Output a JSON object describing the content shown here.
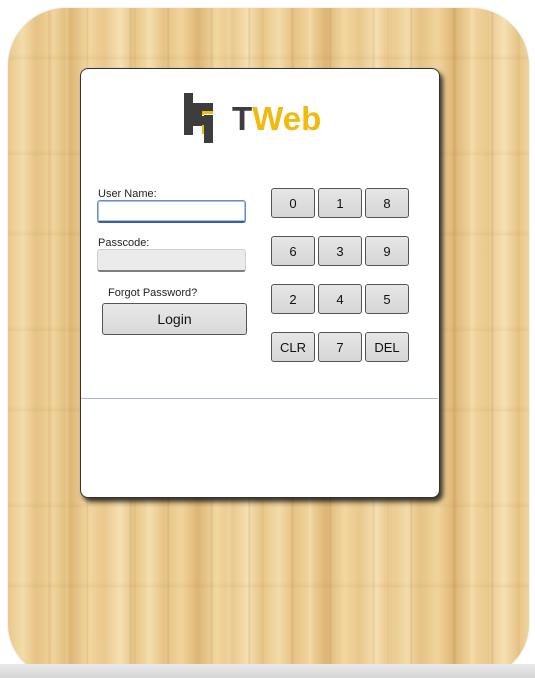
{
  "logo": {
    "t_text": "T",
    "web_text": "Web",
    "brand_yellow": "#f2b90e",
    "brand_gray": "#3d3d3d"
  },
  "form": {
    "username_label": "User Name:",
    "username_value": "",
    "passcode_label": "Passcode:",
    "passcode_value": "",
    "forgot_label": "Forgot Password?",
    "login_label": "Login"
  },
  "keypad": {
    "keys": [
      "0",
      "1",
      "8",
      "6",
      "3",
      "9",
      "2",
      "4",
      "5",
      "CLR",
      "7",
      "DEL"
    ]
  }
}
